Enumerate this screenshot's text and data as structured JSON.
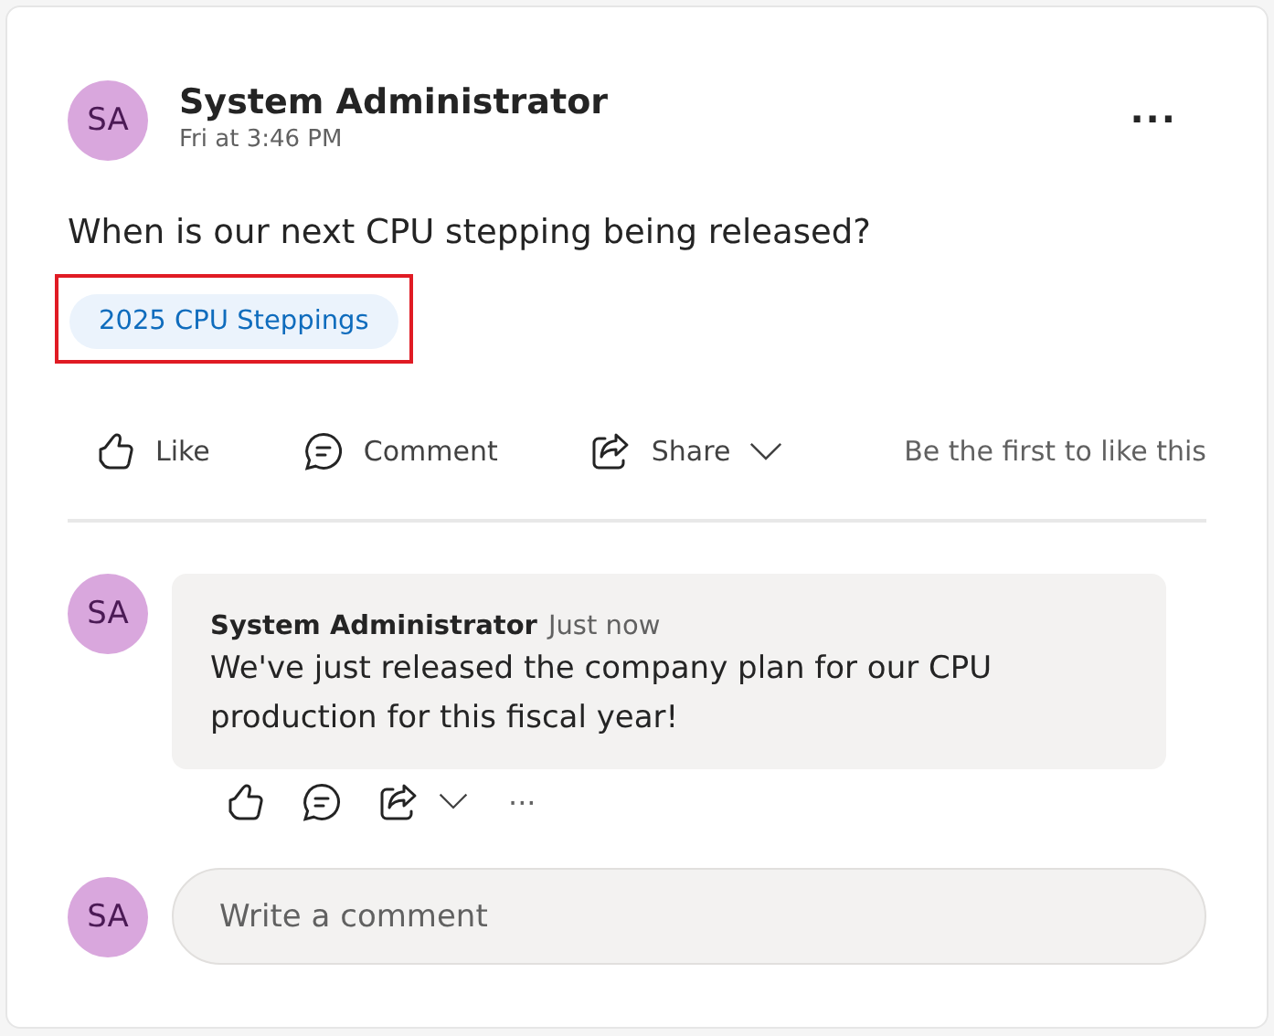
{
  "post": {
    "avatar": "SA",
    "author": "System Administrator",
    "time": "Fri at 3:46 PM",
    "more": "...",
    "question": "When is our next CPU stepping being released?",
    "tag": {
      "label": "2025 CPU Steppings",
      "highlighted": true
    },
    "actions": [
      {
        "kind": "like",
        "label": "Like"
      },
      {
        "kind": "comment",
        "label": "Comment"
      },
      {
        "kind": "share",
        "label": "Share"
      }
    ],
    "like_summary": "Be the first to like this"
  },
  "comments": [
    {
      "avatar": "SA",
      "author": "System Administrator",
      "time": "Just now",
      "text": "We've just released the company plan for our CPU production for this fiscal year!",
      "more": "···"
    }
  ],
  "composer": {
    "avatar": "SA",
    "placeholder": "Write a comment"
  }
}
